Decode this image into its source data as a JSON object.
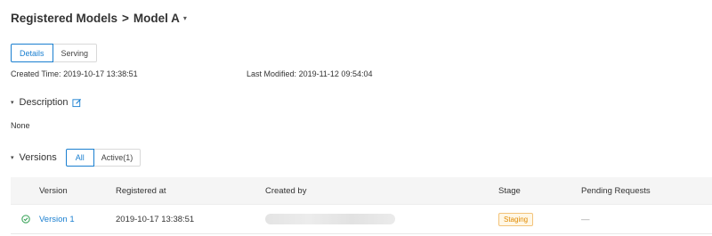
{
  "breadcrumb": {
    "parent": "Registered Models",
    "separator": ">",
    "current": "Model A",
    "caret": "▾"
  },
  "tabs": [
    {
      "label": "Details",
      "active": true
    },
    {
      "label": "Serving",
      "active": false
    }
  ],
  "metadata": {
    "created_label": "Created Time",
    "created_value": "2019-10-17 13:38:51",
    "modified_label": "Last Modified",
    "modified_value": "2019-11-12 09:54:04",
    "colon": ":"
  },
  "description": {
    "toggle": "▾",
    "title": "Description",
    "value": "None",
    "edit_icon": "edit-icon"
  },
  "versions": {
    "toggle": "▾",
    "title": "Versions",
    "filters": [
      {
        "label": "All",
        "active": true
      },
      {
        "label": "Active(1)",
        "active": false
      }
    ],
    "columns": {
      "version": "Version",
      "registered": "Registered at",
      "created_by": "Created by",
      "stage": "Stage",
      "pending": "Pending Requests"
    },
    "rows": [
      {
        "status_icon": "check-circle-icon",
        "version": "Version 1",
        "registered_at": "2019-10-17 13:38:51",
        "stage": "Staging",
        "pending": "—"
      }
    ]
  },
  "colors": {
    "accent": "#1a7fd0",
    "stage_text": "#e08a00",
    "stage_bg": "#fff7e6",
    "status_green": "#2e9e4f"
  }
}
